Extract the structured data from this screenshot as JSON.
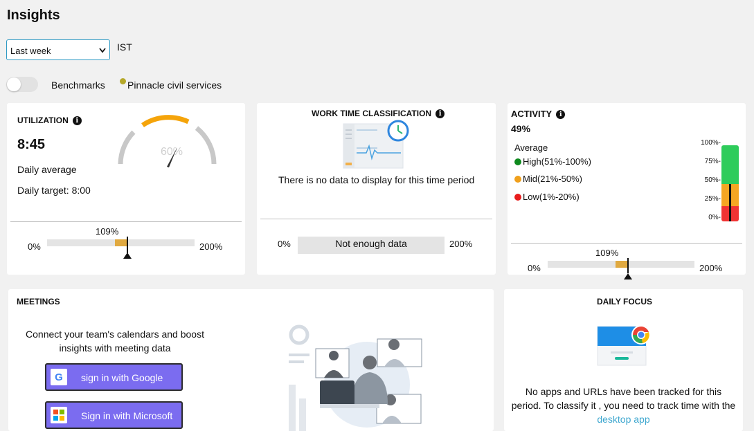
{
  "page": {
    "title": "Insights"
  },
  "filters": {
    "period": "Last week",
    "timezone": "IST"
  },
  "benchmarks": {
    "label": "Benchmarks",
    "enabled": false,
    "org_name": "Pinnacle civil services",
    "org_color": "#b5a829"
  },
  "utilization": {
    "title": "UTILIZATION",
    "value": "8:45",
    "daily_average_label": "Daily average",
    "daily_target_label": "Daily target: 8:00",
    "gauge_label": "60%",
    "scale_min": "0%",
    "scale_max": "200%",
    "percent_label": "109%",
    "percent": 109
  },
  "work_time": {
    "title": "WORK TIME CLASSIFICATION",
    "empty_message": "There is no data to display for this time period",
    "scale_min": "0%",
    "scale_max": "200%",
    "bar_label": "Not enough data"
  },
  "activity": {
    "title": "ACTIVITY",
    "value": "49%",
    "average_label": "Average",
    "legend": [
      {
        "label": "High(51%-100%)",
        "color": "#0f8a1e"
      },
      {
        "label": "Mid(21%-50%)",
        "color": "#f0a01c"
      },
      {
        "label": "Low(1%-20%)",
        "color": "#e81c1c"
      }
    ],
    "axis_ticks": [
      "100%-",
      "75%-",
      "50%-",
      "25%-",
      "0%-"
    ],
    "scale_min": "0%",
    "scale_max": "200%",
    "percent_label": "109%",
    "percent": 109,
    "level": 49,
    "colors": {
      "high": "#2ecc5b",
      "mid": "#f5a623",
      "low": "#f03434"
    }
  },
  "meetings": {
    "title": "MEETINGS",
    "description_line1": "Connect your team's calendars and boost",
    "description_line2": "insights with meeting data",
    "google_button": "sign in with Google",
    "microsoft_button": "Sign in with Microsoft"
  },
  "daily_focus": {
    "title": "DAILY FOCUS",
    "line1": "No apps and URLs have been tracked for this",
    "line2": "period. To classify it , you need to track time with the",
    "link": "desktop app"
  }
}
